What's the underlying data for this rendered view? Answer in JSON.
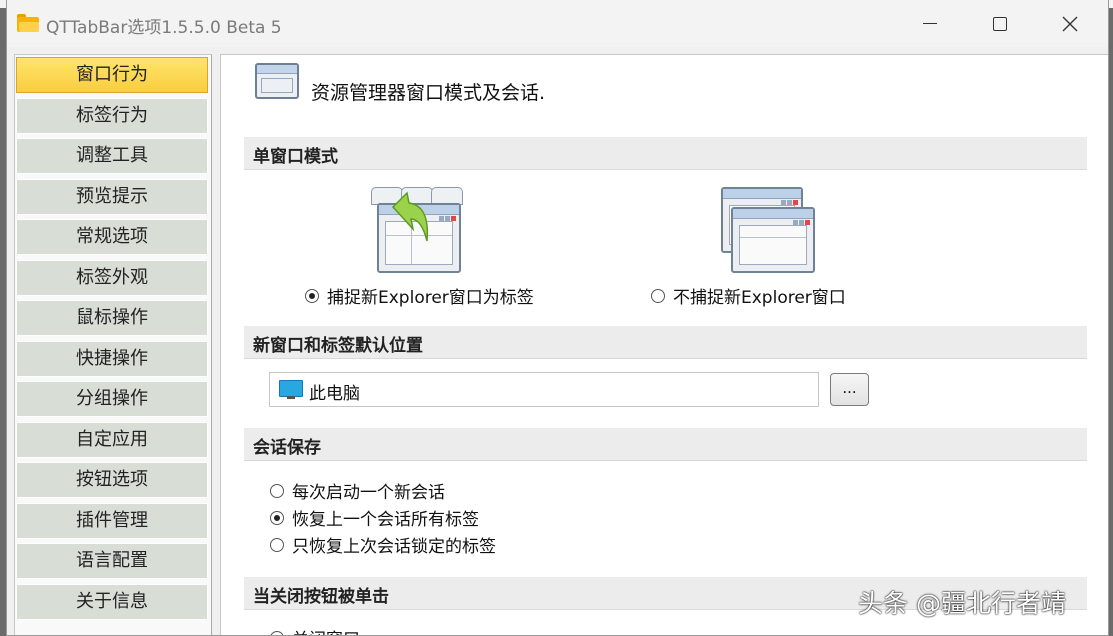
{
  "window": {
    "title": "QTTabBar选项1.5.5.0 Beta 5"
  },
  "sidebar": {
    "items": [
      {
        "label": "窗口行为",
        "active": true
      },
      {
        "label": "标签行为"
      },
      {
        "label": "调整工具"
      },
      {
        "label": "预览提示"
      },
      {
        "label": "常规选项"
      },
      {
        "label": "标签外观"
      },
      {
        "label": "鼠标操作"
      },
      {
        "label": "快捷操作"
      },
      {
        "label": "分组操作"
      },
      {
        "label": "自定应用"
      },
      {
        "label": "按钮选项"
      },
      {
        "label": "插件管理"
      },
      {
        "label": "语言配置"
      },
      {
        "label": "关于信息"
      }
    ]
  },
  "content": {
    "header": "资源管理器窗口模式及会话.",
    "single_window": {
      "title": "单窗口模式",
      "option_capture": "捕捉新Explorer窗口为标签",
      "option_no_capture": "不捕捉新Explorer窗口",
      "selected": "option_capture"
    },
    "default_location": {
      "title": "新窗口和标签默认位置",
      "path": "此电脑",
      "browse_label": "..."
    },
    "session": {
      "title": "会话保存",
      "options": [
        "每次启动一个新会话",
        "恢复上一个会话所有标签",
        "只恢复上次会话锁定的标签"
      ],
      "selected_index": 1
    },
    "close_button": {
      "title": "当关闭按钮被单击",
      "first_option": "关闭窗口"
    }
  },
  "watermark": "头条 @疆北行者靖",
  "colors": {
    "active_nav": "#f9cd3e",
    "nav": "#d8ddd6",
    "section": "#ececec"
  }
}
